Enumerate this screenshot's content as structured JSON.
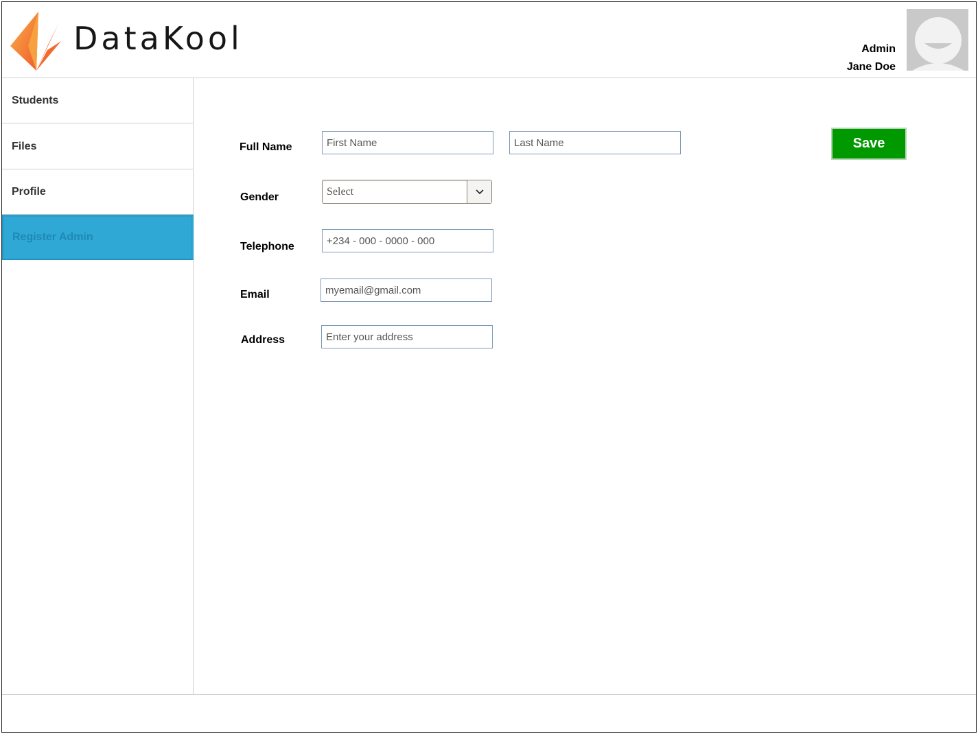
{
  "brand": {
    "name": "DataKool"
  },
  "user": {
    "role": "Admin",
    "name": "Jane Doe"
  },
  "sidebar": {
    "items": [
      {
        "label": "Students"
      },
      {
        "label": "Files"
      },
      {
        "label": "Profile"
      },
      {
        "label": "Register Admin",
        "active": true
      }
    ]
  },
  "form": {
    "full_name_label": "Full Name",
    "first_name_placeholder": "First Name",
    "last_name_placeholder": "Last Name",
    "gender_label": "Gender",
    "gender_selected": "Select",
    "telephone_label": "Telephone",
    "telephone_placeholder": "+234 - 000 - 0000 - 000",
    "email_label": "Email",
    "email_placeholder": "myemail@gmail.com",
    "address_label": "Address",
    "address_placeholder": "Enter your address",
    "save_label": "Save"
  },
  "colors": {
    "accent": "#2fa8d5",
    "save": "#009a00",
    "logo_orange": "#f47b2a"
  }
}
